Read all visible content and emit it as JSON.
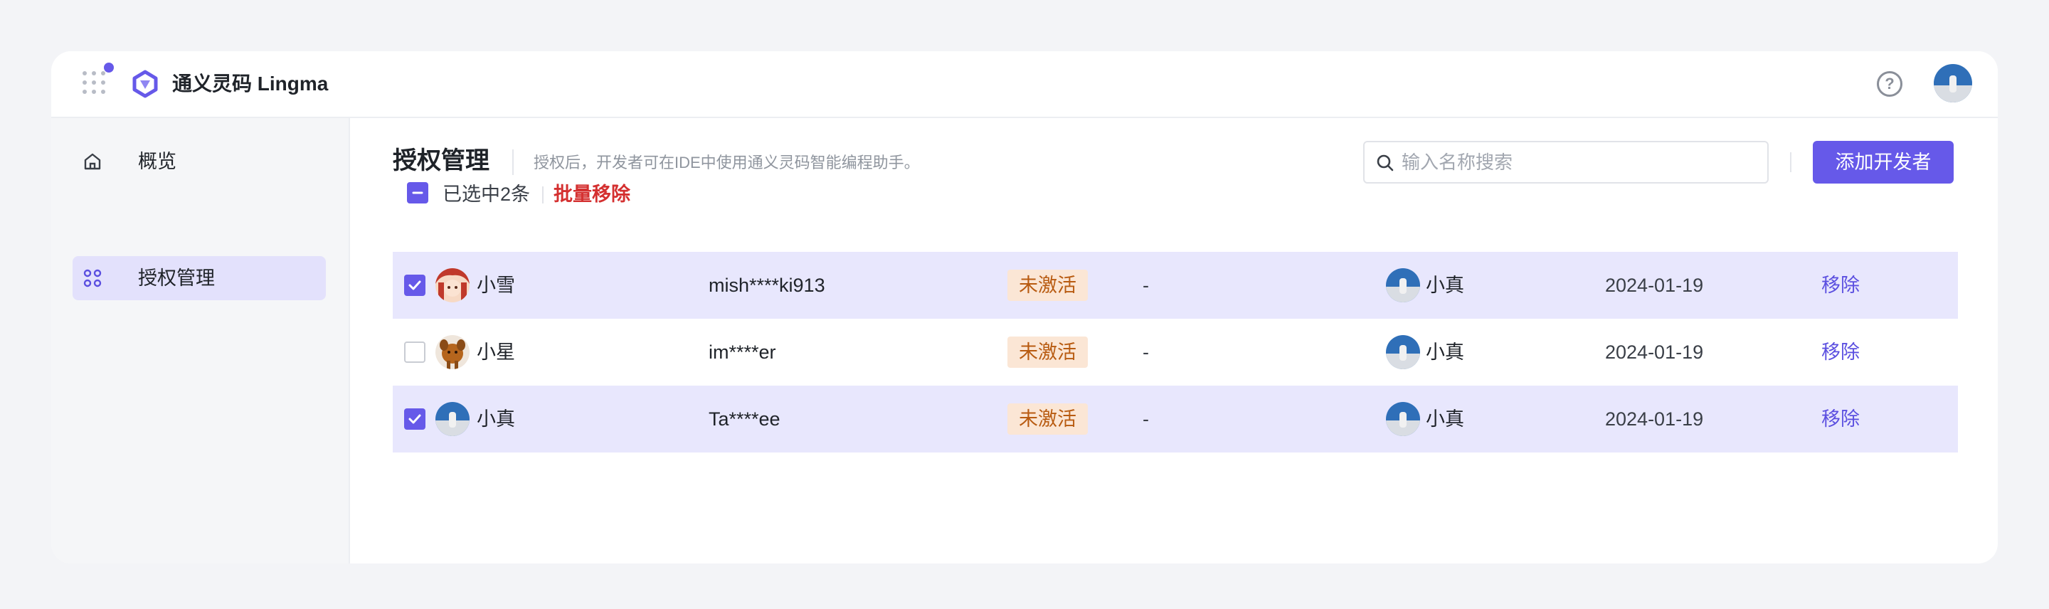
{
  "app": {
    "name": "通义灵码 Lingma",
    "accent_color": "#6659e9",
    "logo_icon": "lingma-logo-icon",
    "apps_icon": "app-grid-icon",
    "help_icon": "help-circle-icon"
  },
  "sidebar": {
    "items": [
      {
        "label": "概览",
        "icon": "home-icon",
        "active": false
      },
      {
        "label": "授权管理",
        "icon": "apps-dots-icon",
        "active": true
      }
    ]
  },
  "main": {
    "title": "授权管理",
    "description": "授权后，开发者可在IDE中使用通义灵码智能编程助手。",
    "search": {
      "placeholder": "输入名称搜索",
      "value": ""
    },
    "add_button": "添加开发者"
  },
  "batch": {
    "selected_text": "已选中2条",
    "remove_label": "批量移除",
    "state": "indeterminate"
  },
  "rows": [
    {
      "checked": true,
      "name": "小雪",
      "account": "mish****ki913",
      "status": "未激活",
      "activated": "-",
      "inviter": "小真",
      "date": "2024-01-19",
      "action": "移除"
    },
    {
      "checked": false,
      "name": "小星",
      "account": "im****er",
      "status": "未激活",
      "activated": "-",
      "inviter": "小真",
      "date": "2024-01-19",
      "action": "移除"
    },
    {
      "checked": true,
      "name": "小真",
      "account": "Ta****ee",
      "status": "未激活",
      "activated": "-",
      "inviter": "小真",
      "date": "2024-01-19",
      "action": "移除"
    }
  ]
}
